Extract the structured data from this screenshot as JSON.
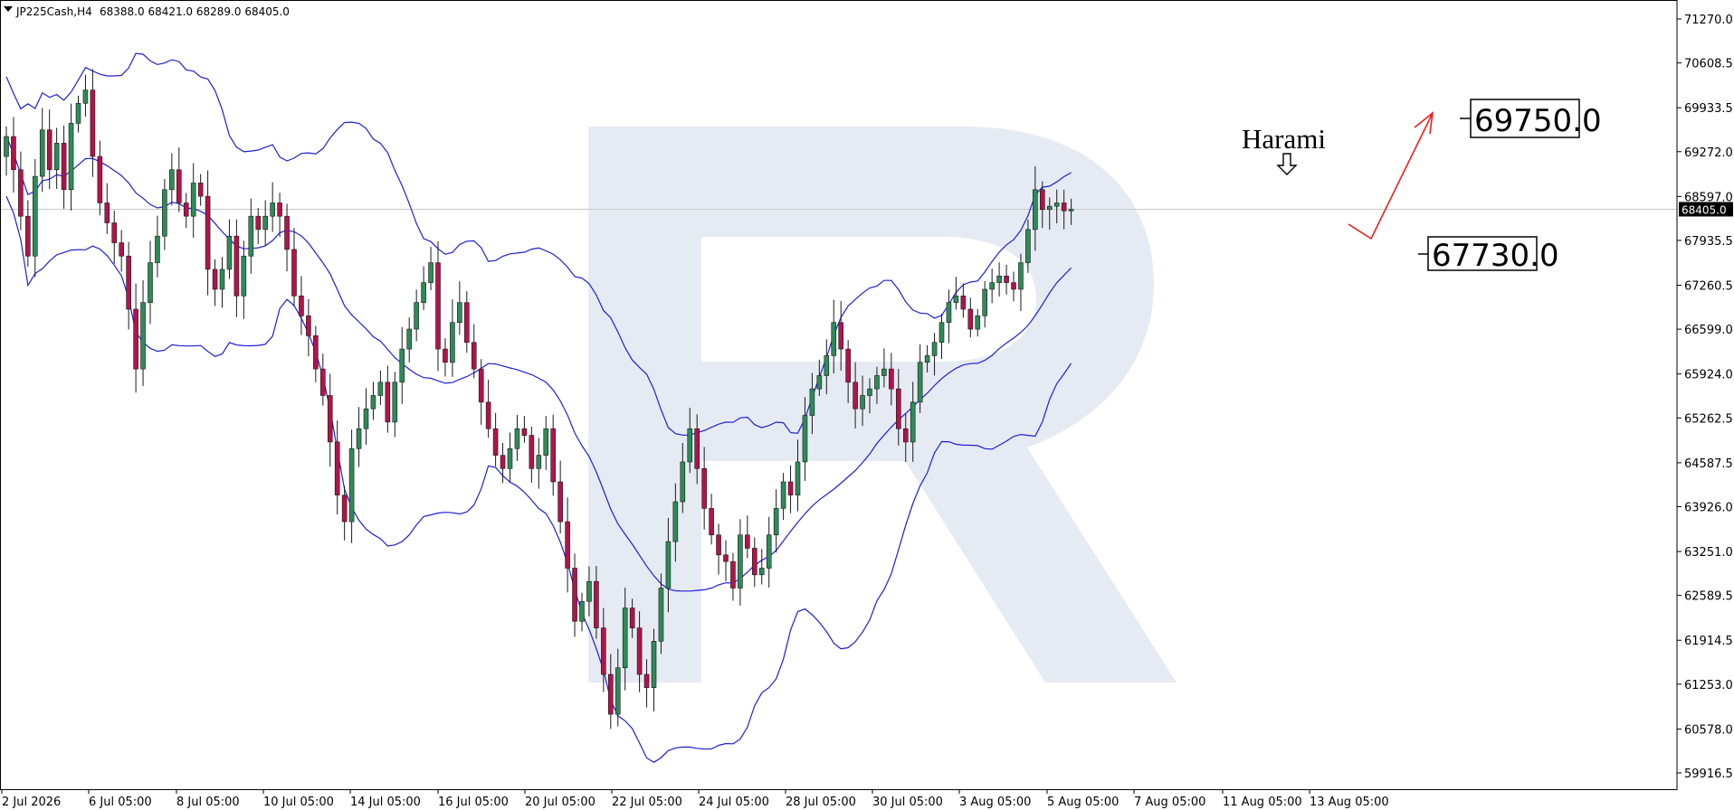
{
  "header": {
    "symbol": "JP225Cash,H4",
    "ohlc": "68388.0 68421.0 68289.0 68405.0"
  },
  "watermark_letter": "R",
  "colors": {
    "bull": "#2e8b57",
    "bear": "#b3134a",
    "band": "#1f1fd6",
    "arrow": "#e8201c",
    "axis": "#000000",
    "current_line": "#c8c8c8",
    "watermark": "#e6ebf3"
  },
  "chart_data": {
    "type": "candlestick",
    "title": "",
    "xlabel": "",
    "ylabel": "",
    "ylim": [
      59600,
      71500
    ],
    "y_ticks": [
      "71270.0",
      "70608.5",
      "69933.5",
      "69272.0",
      "68597.0",
      "67935.5",
      "67260.5",
      "66599.0",
      "65924.0",
      "65262.5",
      "64587.5",
      "63926.0",
      "63251.0",
      "62589.5",
      "61914.5",
      "61253.0",
      "60578.0",
      "59916.5"
    ],
    "x_ticks": [
      "2 Jul 2026",
      "6 Jul 05:00",
      "8 Jul 05:00",
      "10 Jul 05:00",
      "14 Jul 05:00",
      "16 Jul 05:00",
      "20 Jul 05:00",
      "22 Jul 05:00",
      "24 Jul 05:00",
      "28 Jul 05:00",
      "30 Jul 05:00",
      "3 Aug 05:00",
      "5 Aug 05:00",
      "7 Aug 05:00",
      "11 Aug 05:00",
      "13 Aug 05:00"
    ],
    "current_price": "68405.0",
    "indicator": "Bollinger Bands",
    "annotations": {
      "pattern": "Harami",
      "target_up": "69750.0",
      "target_down": "67730.0"
    },
    "closes": [
      69500,
      69000,
      68300,
      67700,
      68900,
      69600,
      69000,
      69400,
      68700,
      69700,
      70000,
      70200,
      69200,
      68500,
      68200,
      67900,
      67700,
      66900,
      66000,
      67000,
      67600,
      68000,
      68700,
      69000,
      68500,
      68300,
      68800,
      68600,
      67500,
      67200,
      67500,
      68000,
      67100,
      67700,
      68300,
      68100,
      68300,
      68500,
      68300,
      67800,
      67100,
      66800,
      66500,
      66000,
      65600,
      64900,
      64100,
      63700,
      64800,
      65100,
      65400,
      65600,
      65800,
      65200,
      65800,
      66300,
      66600,
      67000,
      67300,
      67600,
      66300,
      66100,
      66700,
      67000,
      66400,
      66000,
      65500,
      65100,
      64700,
      64500,
      64800,
      65100,
      65000,
      64500,
      64700,
      65100,
      64300,
      63700,
      63000,
      62200,
      62500,
      62800,
      62100,
      61400,
      60800,
      61500,
      62400,
      62100,
      61400,
      61200,
      61900,
      62700,
      63400,
      64000,
      64600,
      65100,
      64500,
      63900,
      63500,
      63200,
      63100,
      62700,
      63500,
      63300,
      62900,
      63000,
      63500,
      63900,
      64300,
      64100,
      64600,
      65300,
      65700,
      65900,
      66200,
      66700,
      66300,
      65800,
      65400,
      65600,
      65700,
      65900,
      66000,
      65700,
      65100,
      64900,
      65500,
      66100,
      66200,
      66400,
      66700,
      67000,
      67100,
      66900,
      66600,
      66800,
      67200,
      67300,
      67400,
      67300,
      67200,
      67600,
      68100,
      68700,
      68400,
      68450,
      68500,
      68380,
      68405
    ]
  }
}
